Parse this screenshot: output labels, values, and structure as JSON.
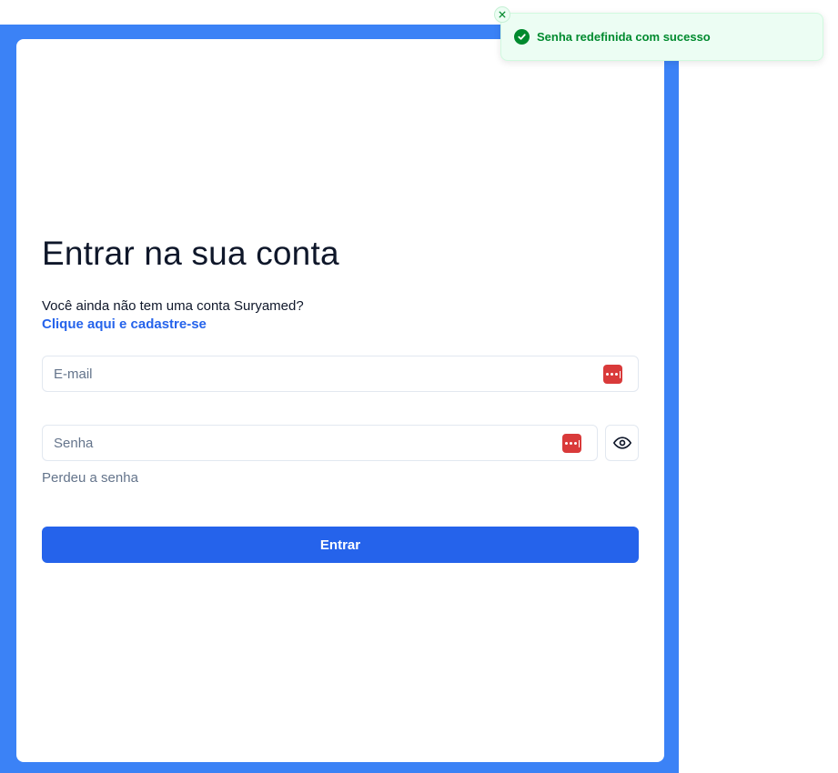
{
  "login": {
    "title": "Entrar na sua conta",
    "subtitle": "Você ainda não tem uma conta Suryamed?",
    "signup_link": "Clique aqui e cadastre-se",
    "email_placeholder": "E-mail",
    "email_value": "",
    "password_placeholder": "Senha",
    "password_value": "",
    "forgot_link": "Perdeu a senha",
    "submit_label": "Entrar"
  },
  "toast": {
    "message": "Senha redefinida com sucesso",
    "status": "success",
    "close_icon": "close-icon",
    "status_icon": "check-circle-icon"
  },
  "icons": {
    "password_manager": "password-manager-icon",
    "show_password": "eye-icon"
  },
  "colors": {
    "accent": "#2563eb",
    "panel": "#3b82f6",
    "success": "#008a2e",
    "success_bg": "#ecfdf3",
    "password_manager": "#d93a3a"
  }
}
